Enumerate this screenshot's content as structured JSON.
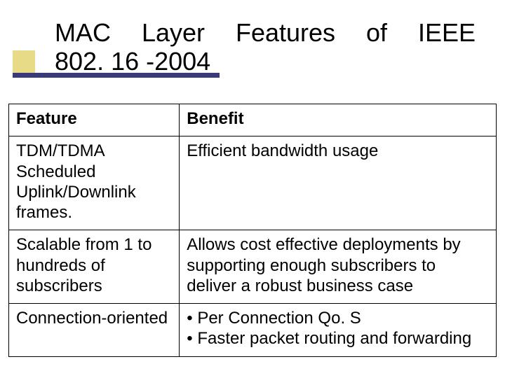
{
  "title": {
    "line1": "MAC Layer Features of IEEE",
    "line2": "802. 16 -2004"
  },
  "table": {
    "headers": {
      "feature": "Feature",
      "benefit": "Benefit"
    },
    "rows": [
      {
        "feature": "TDM/TDMA Scheduled Uplink/Downlink frames.",
        "benefit": "Efficient bandwidth usage"
      },
      {
        "feature": "Scalable from 1 to hundreds of subscribers",
        "benefit": "Allows cost effective deployments by supporting enough subscribers to deliver a robust business case"
      },
      {
        "feature": "Connection-oriented",
        "benefit_bullets": [
          "• Per Connection Qo. S",
          "• Faster packet routing and forwarding"
        ]
      }
    ]
  }
}
